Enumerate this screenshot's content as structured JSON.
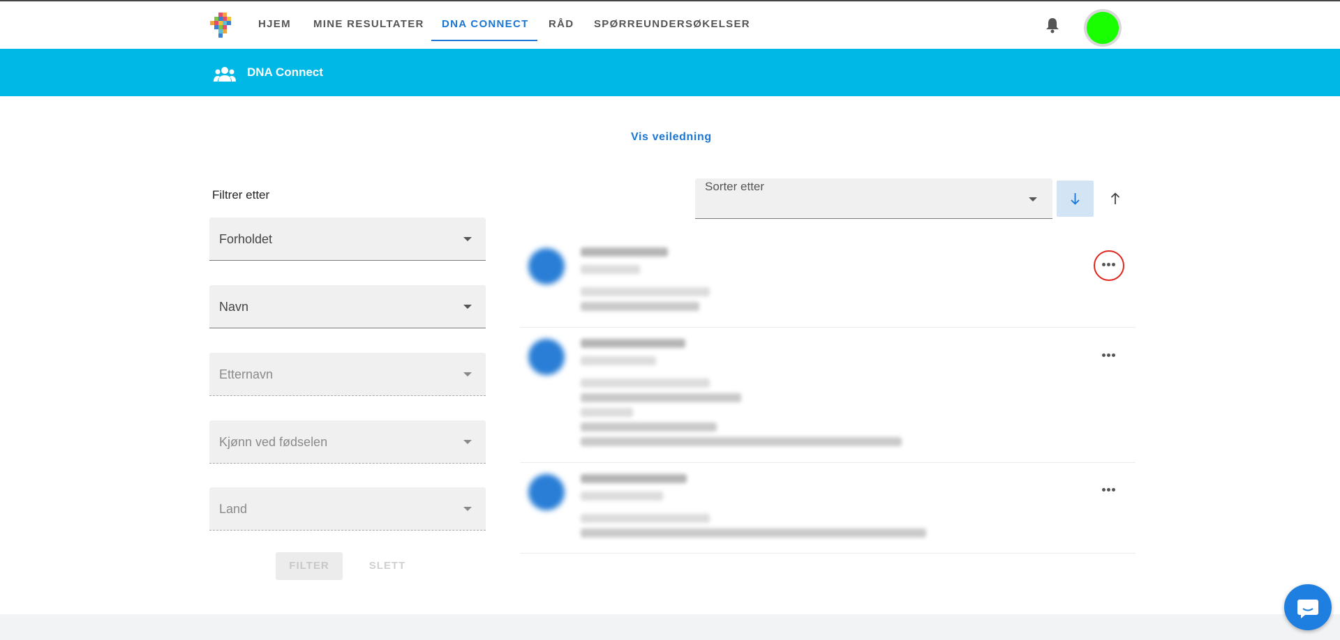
{
  "nav": {
    "items": [
      {
        "label": "HJEM"
      },
      {
        "label": "MINE RESULTATER"
      },
      {
        "label": "DNA CONNECT",
        "active": true
      },
      {
        "label": "RÅD"
      },
      {
        "label": "SPØRREUNDERSØKELSER"
      }
    ],
    "avatar_color": "#1aff00",
    "accent_color": "#1976d2"
  },
  "header": {
    "title": "DNA Connect",
    "band_color": "#00b8e6",
    "icon": "group-icon"
  },
  "guide_link": "Vis veiledning",
  "filters": {
    "heading": "Filtrer etter",
    "fields": [
      {
        "label": "Forholdet",
        "enabled": true
      },
      {
        "label": "Navn",
        "enabled": true
      },
      {
        "label": "Etternavn",
        "enabled": false
      },
      {
        "label": "Kjønn ved fødselen",
        "enabled": false
      },
      {
        "label": "Land",
        "enabled": false
      }
    ],
    "filter_button": "FILTER",
    "clear_button": "SLETT"
  },
  "sort": {
    "label": "Sorter etter",
    "desc_icon": "arrow-down-icon",
    "asc_icon": "arrow-up-icon"
  },
  "matches": {
    "count_visible": 3,
    "more_icon": "more-horizontal-icon",
    "highlighted_index": 0
  },
  "chat": {
    "icon": "chat-bubble-icon"
  }
}
